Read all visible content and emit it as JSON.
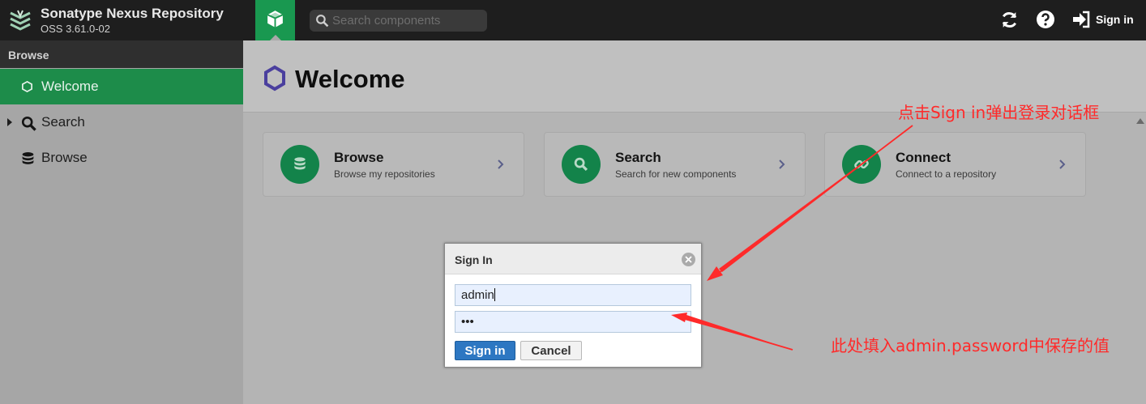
{
  "header": {
    "app_title": "Sonatype Nexus Repository",
    "version": "OSS 3.61.0-02",
    "search_placeholder": "Search components",
    "sign_in_label": "Sign in",
    "icons": [
      "nexus-logo-icon",
      "cube-icon",
      "search-icon",
      "refresh-icon",
      "help-icon",
      "sign-in-icon"
    ],
    "accent_color": "#199850"
  },
  "sidebar": {
    "header": "Browse",
    "items": [
      {
        "label": "Welcome",
        "icon": "hexagon-icon",
        "active": true
      },
      {
        "label": "Search",
        "icon": "search-icon",
        "expandable": true
      },
      {
        "label": "Browse",
        "icon": "database-icon"
      }
    ]
  },
  "main": {
    "title": "Welcome",
    "cards": [
      {
        "title": "Browse",
        "subtitle": "Browse my repositories",
        "icon": "database-icon"
      },
      {
        "title": "Search",
        "subtitle": "Search for new components",
        "icon": "search-icon"
      },
      {
        "title": "Connect",
        "subtitle": "Connect to a repository",
        "icon": "link-icon"
      }
    ]
  },
  "dialog": {
    "title": "Sign In",
    "username_value": "admin",
    "password_value": "•••",
    "sign_in_button": "Sign in",
    "cancel_button": "Cancel"
  },
  "annotations": {
    "text_1": "点击Sign in弹出登录对话框",
    "text_2": "此处填入admin.password中保存的值",
    "color": "#ff2a2a"
  }
}
